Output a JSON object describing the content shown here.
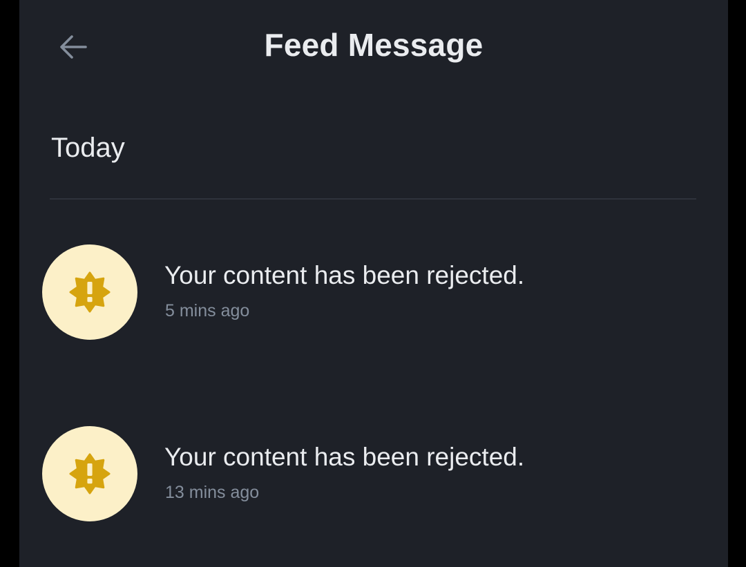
{
  "header": {
    "title": "Feed Message",
    "back_icon": "arrow-left-icon"
  },
  "section": {
    "title": "Today"
  },
  "messages": [
    {
      "text": "Your content has been rejected.",
      "time": "5 mins ago",
      "icon": "warning-badge-icon"
    },
    {
      "text": "Your content has been rejected.",
      "time": "13 mins ago",
      "icon": "warning-badge-icon"
    }
  ],
  "colors": {
    "background": "#1e2128",
    "text_primary": "#eaecef",
    "text_secondary": "#848e9c",
    "icon_bg": "#fcf0c8",
    "icon_accent": "#d6a40f"
  }
}
